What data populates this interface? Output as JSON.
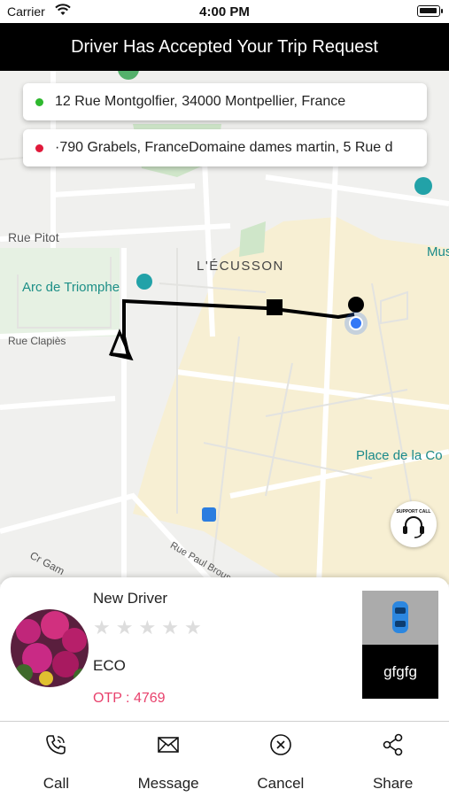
{
  "status_bar": {
    "carrier": "Carrier",
    "time": "4:00 PM"
  },
  "title": "Driver Has Accepted Your Trip Request",
  "pickup": {
    "address": "12 Rue Montgolfier, 34000 Montpellier, France",
    "dot_color": "#2eb82e"
  },
  "dropoff": {
    "address": "·790 Grabels, FranceDomaine dames martin, 5 Rue d",
    "dot_color": "#e0193a"
  },
  "map": {
    "labels": {
      "rue_pitot": "Rue Pitot",
      "arc": "Arc de Triomphe",
      "district": "L'ÉCUSSON",
      "rue_clapies": "Rue Clapiès",
      "place": "Place de la Co",
      "musee": "Mus",
      "rue_paul": "Rue Paul Brous",
      "cr": "Cr Gam"
    }
  },
  "support": {
    "label": "SUPPORT CALL"
  },
  "driver": {
    "name": "New Driver",
    "rating": 0,
    "max_rating": 5,
    "vehicle_type": "ECO",
    "otp": "OTP : 4769",
    "plate": "gfgfg"
  },
  "actions": [
    {
      "label": "Call",
      "icon": "phone-icon"
    },
    {
      "label": "Message",
      "icon": "envelope-icon"
    },
    {
      "label": "Cancel",
      "icon": "cancel-icon"
    },
    {
      "label": "Share",
      "icon": "share-icon"
    }
  ],
  "colors": {
    "accent_otp": "#e8416c",
    "route": "#000000",
    "user_location": "#3478f6"
  }
}
